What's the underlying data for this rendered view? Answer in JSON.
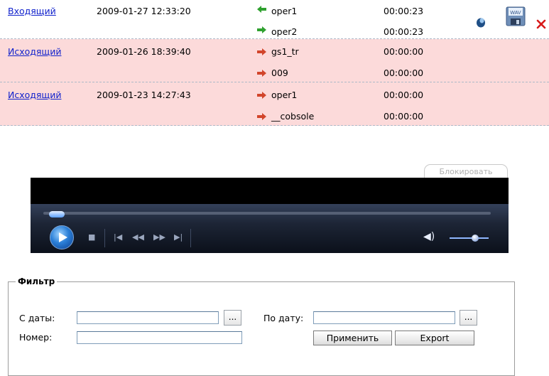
{
  "calls": [
    {
      "type": "Входящий",
      "datetime": "2009-01-27 12:33:20",
      "style": "incoming",
      "lines": [
        {
          "party": "oper1",
          "duration": "00:00:23",
          "arrow_color": "#2fa12f"
        },
        {
          "party": "oper2",
          "duration": "00:00:23",
          "arrow_color": "#2fa12f"
        }
      ]
    },
    {
      "type": "Исходящий",
      "datetime": "2009-01-26 18:39:40",
      "style": "outgoing",
      "lines": [
        {
          "party": "gs1_tr",
          "duration": "00:00:00",
          "arrow_color": "#d2452b"
        },
        {
          "party": "009",
          "duration": "00:00:00",
          "arrow_color": "#d2452b"
        }
      ]
    },
    {
      "type": "Исходящий",
      "datetime": "2009-01-23 14:27:43",
      "style": "outgoing",
      "lines": [
        {
          "party": "oper1",
          "duration": "00:00:00",
          "arrow_color": "#d2452b"
        },
        {
          "party": "__cobsole",
          "duration": "00:00:00",
          "arrow_color": "#d2452b"
        }
      ]
    }
  ],
  "row_actions": {
    "play_icon": "player-icon",
    "wav_icon": "wav-save-icon",
    "wav_label": "WAV",
    "delete_icon": "delete-x-icon",
    "delete_color": "#d81b1b"
  },
  "player": {
    "block_label": "Блокировать",
    "progress": 0.0,
    "volume": 0.6
  },
  "filter": {
    "legend": "Фильтр",
    "from_label": "С даты:",
    "from_value": "",
    "to_label": "По дату:",
    "to_value": "",
    "number_label": "Номер:",
    "number_value": "",
    "dots_label": "...",
    "apply_label": "Применить",
    "export_label": "Export"
  },
  "colors": {
    "outgoing_row_bg": "#fcdada",
    "link": "#1122cc",
    "dashed_border": "#aeb9c8"
  }
}
